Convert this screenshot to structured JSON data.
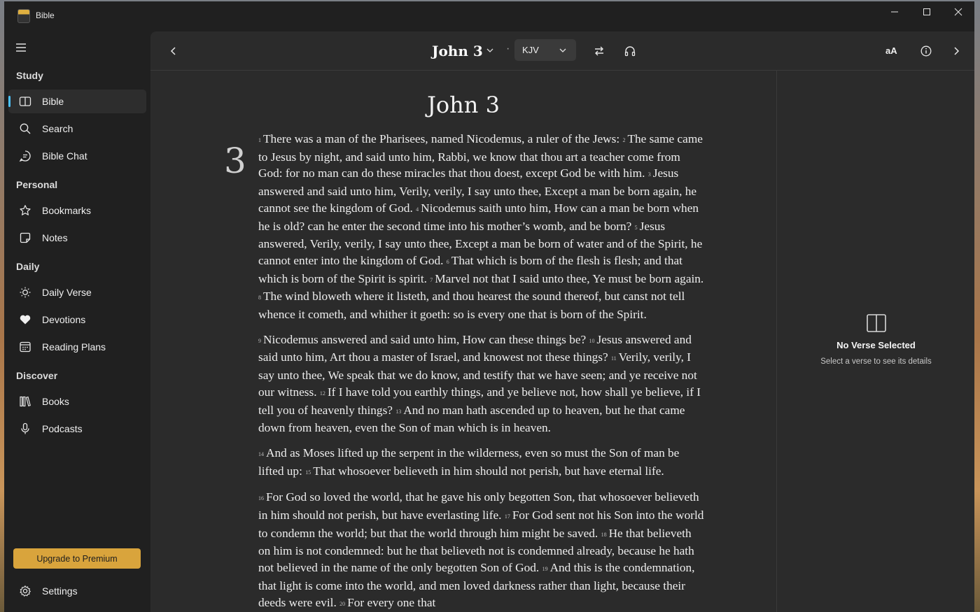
{
  "window": {
    "title": "Bible"
  },
  "sidebar": {
    "sections": {
      "study": "Study",
      "personal": "Personal",
      "daily": "Daily",
      "discover": "Discover"
    },
    "items": {
      "bible": "Bible",
      "search": "Search",
      "bible_chat": "Bible Chat",
      "bookmarks": "Bookmarks",
      "notes": "Notes",
      "daily_verse": "Daily Verse",
      "devotions": "Devotions",
      "reading_plans": "Reading Plans",
      "books": "Books",
      "podcasts": "Podcasts"
    },
    "upgrade_label": "Upgrade to Premium",
    "settings_label": "Settings"
  },
  "toolbar": {
    "book_chapter": "John 3",
    "separator": "·",
    "version": "KJV",
    "font_size_label": "aA"
  },
  "reader": {
    "heading": "John 3",
    "chapter_number": "3",
    "paragraphs": [
      [
        {
          "n": "1",
          "t": "There was a man of the Pharisees, named Nicodemus, a ruler of the Jews:"
        },
        {
          "n": "2",
          "t": "The same came to Jesus by night, and said unto him, Rabbi, we know that thou art a teacher come from God: for no man can do these miracles that thou doest, except God be with him."
        },
        {
          "n": "3",
          "t": "Jesus answered and said unto him, Verily, verily, I say unto thee, Except a man be born again, he cannot see the kingdom of God."
        },
        {
          "n": "4",
          "t": "Nicodemus saith unto him, How can a man be born when he is old? can he enter the second time into his mother’s womb, and be born?"
        },
        {
          "n": "5",
          "t": "Jesus answered, Verily, verily, I say unto thee, Except a man be born of water and of the Spirit, he cannot enter into the kingdom of God."
        },
        {
          "n": "6",
          "t": "That which is born of the flesh is flesh; and that which is born of the Spirit is spirit."
        },
        {
          "n": "7",
          "t": "Marvel not that I said unto thee, Ye must be born again."
        },
        {
          "n": "8",
          "t": "The wind bloweth where it listeth, and thou hearest the sound thereof, but canst not tell whence it cometh, and whither it goeth: so is every one that is born of the Spirit."
        }
      ],
      [
        {
          "n": "9",
          "t": "Nicodemus answered and said unto him, How can these things be?"
        },
        {
          "n": "10",
          "t": "Jesus answered and said unto him, Art thou a master of Israel, and knowest not these things?"
        },
        {
          "n": "11",
          "t": "Verily, verily, I say unto thee, We speak that we do know, and testify that we have seen; and ye receive not our witness."
        },
        {
          "n": "12",
          "t": "If I have told you earthly things, and ye believe not, how shall ye believe, if I tell you of heavenly things?"
        },
        {
          "n": "13",
          "t": "And no man hath ascended up to heaven, but he that came down from heaven, even the Son of man which is in heaven."
        }
      ],
      [
        {
          "n": "14",
          "t": "And as Moses lifted up the serpent in the wilderness, even so must the Son of man be lifted up:"
        },
        {
          "n": "15",
          "t": "That whosoever believeth in him should not perish, but have eternal life."
        }
      ],
      [
        {
          "n": "16",
          "t": "For God so loved the world, that he gave his only begotten Son, that whosoever believeth in him should not perish, but have everlasting life."
        },
        {
          "n": "17",
          "t": "For God sent not his Son into the world to condemn the world; but that the world through him might be saved."
        },
        {
          "n": "18",
          "t": "He that believeth on him is not condemned: but he that believeth not is condemned already, because he hath not believed in the name of the only begotten Son of God."
        },
        {
          "n": "19",
          "t": "And this is the condemnation, that light is come into the world, and men loved darkness rather than light, because their deeds were evil."
        },
        {
          "n": "20",
          "t": "For every one that"
        }
      ]
    ]
  },
  "details": {
    "title": "No Verse Selected",
    "hint": "Select a verse to see its details"
  },
  "colors": {
    "accent": "#4cc2ff",
    "premium": "#d9a43c",
    "window_bg": "#202020",
    "panel_bg": "#2b2b2b"
  },
  "icons": {
    "sidebar": [
      "menu-icon",
      "book-open-icon",
      "search-icon",
      "chat-icon",
      "star-icon",
      "note-icon",
      "sun-icon",
      "heart-icon",
      "calendar-icon",
      "library-icon",
      "microphone-icon",
      "gear-icon"
    ],
    "toolbar": [
      "chevron-left-icon",
      "chevron-down-icon",
      "swap-icon",
      "headphones-icon",
      "info-icon",
      "chevron-right-icon"
    ]
  }
}
